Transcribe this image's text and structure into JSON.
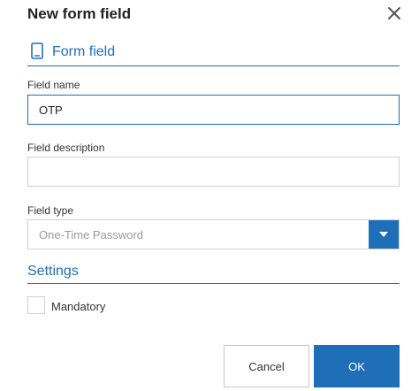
{
  "dialog": {
    "title": "New form field",
    "close_icon": "close-icon"
  },
  "form_section": {
    "title": "Form field",
    "icon": "mobile-device-icon"
  },
  "fields": {
    "name": {
      "label": "Field name",
      "value": "OTP",
      "placeholder": ""
    },
    "description": {
      "label": "Field description",
      "value": "",
      "placeholder": ""
    },
    "type": {
      "label": "Field type",
      "selected": "One-Time Password",
      "arrow_icon": "chevron-down-icon"
    }
  },
  "settings": {
    "title": "Settings",
    "mandatory": {
      "label": "Mandatory",
      "checked": false
    }
  },
  "buttons": {
    "cancel": "Cancel",
    "ok": "OK"
  },
  "colors": {
    "accent": "#1e6fb8",
    "border": "#d0d0d0",
    "placeholder_text": "#9a9a9a"
  }
}
